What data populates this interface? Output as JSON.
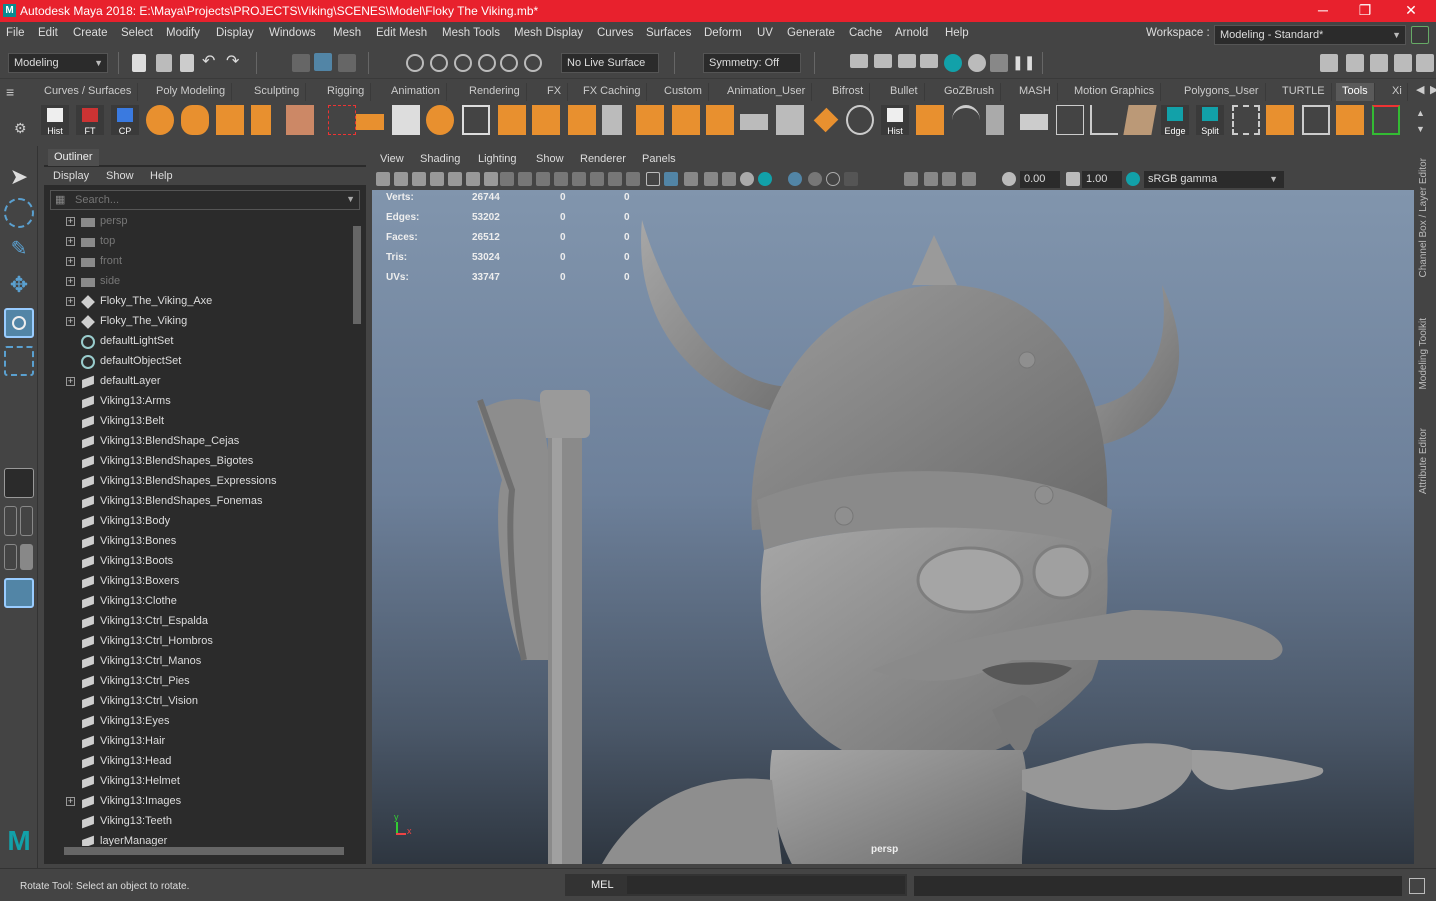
{
  "window": {
    "title": "Autodesk Maya 2018: E:\\Maya\\Projects\\PROJECTS\\Viking\\SCENES\\Model\\Floky The Viking.mb*",
    "logo_letter": "M",
    "minimize": "─",
    "maximize": "❐",
    "close": "✕"
  },
  "menubar": {
    "items": [
      "File",
      "Edit",
      "Create",
      "Select",
      "Modify",
      "Display",
      "Windows",
      "Mesh",
      "Edit Mesh",
      "Mesh Tools",
      "Mesh Display",
      "Curves",
      "Surfaces",
      "Deform",
      "UV",
      "Generate",
      "Cache",
      "Arnold",
      "Help"
    ],
    "workspace_label": "Workspace :",
    "workspace_value": "Modeling - Standard*"
  },
  "statusline": {
    "mode": "Modeling",
    "live_surface": "No Live Surface",
    "symmetry": "Symmetry: Off"
  },
  "shelf": {
    "tabs": [
      "Curves / Surfaces",
      "Poly Modeling",
      "Sculpting",
      "Rigging",
      "Animation",
      "Rendering",
      "FX",
      "FX Caching",
      "Custom",
      "Animation_User",
      "Bifrost",
      "Bullet",
      "GoZBrush",
      "MASH",
      "Motion Graphics",
      "Polygons_User",
      "TURTLE",
      "Tools",
      "Xi"
    ],
    "active_tab": "Tools",
    "labels": {
      "hist1": "Hist",
      "ft": "FT",
      "cp": "CP",
      "hist2": "Hist",
      "edge": "Edge",
      "split": "Split"
    }
  },
  "colors": {
    "accent_orange": "#e8902f",
    "title_red": "#e8212d",
    "selection_blue": "#5285a6",
    "maya_teal": "#12a1a9"
  },
  "outliner": {
    "title": "Outliner",
    "menu": [
      "Display",
      "Show",
      "Help"
    ],
    "search_placeholder": "Search...",
    "items": [
      {
        "label": "persp",
        "icon": "camera",
        "expand": true,
        "dim": true
      },
      {
        "label": "top",
        "icon": "camera",
        "expand": true,
        "dim": true
      },
      {
        "label": "front",
        "icon": "camera",
        "expand": true,
        "dim": true
      },
      {
        "label": "side",
        "icon": "camera",
        "expand": true,
        "dim": true
      },
      {
        "label": "Floky_The_Viking_Axe",
        "icon": "transform",
        "expand": true,
        "dim": false
      },
      {
        "label": "Floky_The_Viking",
        "icon": "transform",
        "expand": true,
        "dim": false
      },
      {
        "label": "defaultLightSet",
        "icon": "set",
        "expand": false,
        "dim": false
      },
      {
        "label": "defaultObjectSet",
        "icon": "set",
        "expand": false,
        "dim": false
      },
      {
        "label": "defaultLayer",
        "icon": "layer",
        "expand": true,
        "dim": false
      },
      {
        "label": "Viking13:Arms",
        "icon": "layer",
        "expand": false,
        "dim": false
      },
      {
        "label": "Viking13:Belt",
        "icon": "layer",
        "expand": false,
        "dim": false
      },
      {
        "label": "Viking13:BlendShape_Cejas",
        "icon": "layer",
        "expand": false,
        "dim": false
      },
      {
        "label": "Viking13:BlendShapes_Bigotes",
        "icon": "layer",
        "expand": false,
        "dim": false
      },
      {
        "label": "Viking13:BlendShapes_Expressions",
        "icon": "layer",
        "expand": false,
        "dim": false
      },
      {
        "label": "Viking13:BlendShapes_Fonemas",
        "icon": "layer",
        "expand": false,
        "dim": false
      },
      {
        "label": "Viking13:Body",
        "icon": "layer",
        "expand": false,
        "dim": false
      },
      {
        "label": "Viking13:Bones",
        "icon": "layer",
        "expand": false,
        "dim": false
      },
      {
        "label": "Viking13:Boots",
        "icon": "layer",
        "expand": false,
        "dim": false
      },
      {
        "label": "Viking13:Boxers",
        "icon": "layer",
        "expand": false,
        "dim": false
      },
      {
        "label": "Viking13:Clothe",
        "icon": "layer",
        "expand": false,
        "dim": false
      },
      {
        "label": "Viking13:Ctrl_Espalda",
        "icon": "layer",
        "expand": false,
        "dim": false
      },
      {
        "label": "Viking13:Ctrl_Hombros",
        "icon": "layer",
        "expand": false,
        "dim": false
      },
      {
        "label": "Viking13:Ctrl_Manos",
        "icon": "layer",
        "expand": false,
        "dim": false
      },
      {
        "label": "Viking13:Ctrl_Pies",
        "icon": "layer",
        "expand": false,
        "dim": false
      },
      {
        "label": "Viking13:Ctrl_Vision",
        "icon": "layer",
        "expand": false,
        "dim": false
      },
      {
        "label": "Viking13:Eyes",
        "icon": "layer",
        "expand": false,
        "dim": false
      },
      {
        "label": "Viking13:Hair",
        "icon": "layer",
        "expand": false,
        "dim": false
      },
      {
        "label": "Viking13:Head",
        "icon": "layer",
        "expand": false,
        "dim": false
      },
      {
        "label": "Viking13:Helmet",
        "icon": "layer",
        "expand": false,
        "dim": false
      },
      {
        "label": "Viking13:Images",
        "icon": "layer",
        "expand": true,
        "dim": false
      },
      {
        "label": "Viking13:Teeth",
        "icon": "layer",
        "expand": false,
        "dim": false
      },
      {
        "label": "layerManager",
        "icon": "layer",
        "expand": false,
        "dim": false
      }
    ]
  },
  "viewport": {
    "menu": [
      "View",
      "Shading",
      "Lighting",
      "Show",
      "Renderer",
      "Panels"
    ],
    "near_clip": "0.00",
    "far_clip": "1.00",
    "color_space": "sRGB gamma",
    "camera_label": "persp",
    "axis_y": "y",
    "axis_x": "x",
    "hud": [
      {
        "label": "Verts:",
        "values": [
          "26744",
          "0",
          "0"
        ]
      },
      {
        "label": "Edges:",
        "values": [
          "53202",
          "0",
          "0"
        ]
      },
      {
        "label": "Faces:",
        "values": [
          "26512",
          "0",
          "0"
        ]
      },
      {
        "label": "Tris:",
        "values": [
          "53024",
          "0",
          "0"
        ]
      },
      {
        "label": "UVs:",
        "values": [
          "33747",
          "0",
          "0"
        ]
      }
    ]
  },
  "side_tabs": [
    "Channel Box / Layer Editor",
    "Modeling Toolkit",
    "Attribute Editor"
  ],
  "helpline": {
    "text": "Rotate Tool: Select an object to rotate.",
    "mel_label": "MEL"
  }
}
